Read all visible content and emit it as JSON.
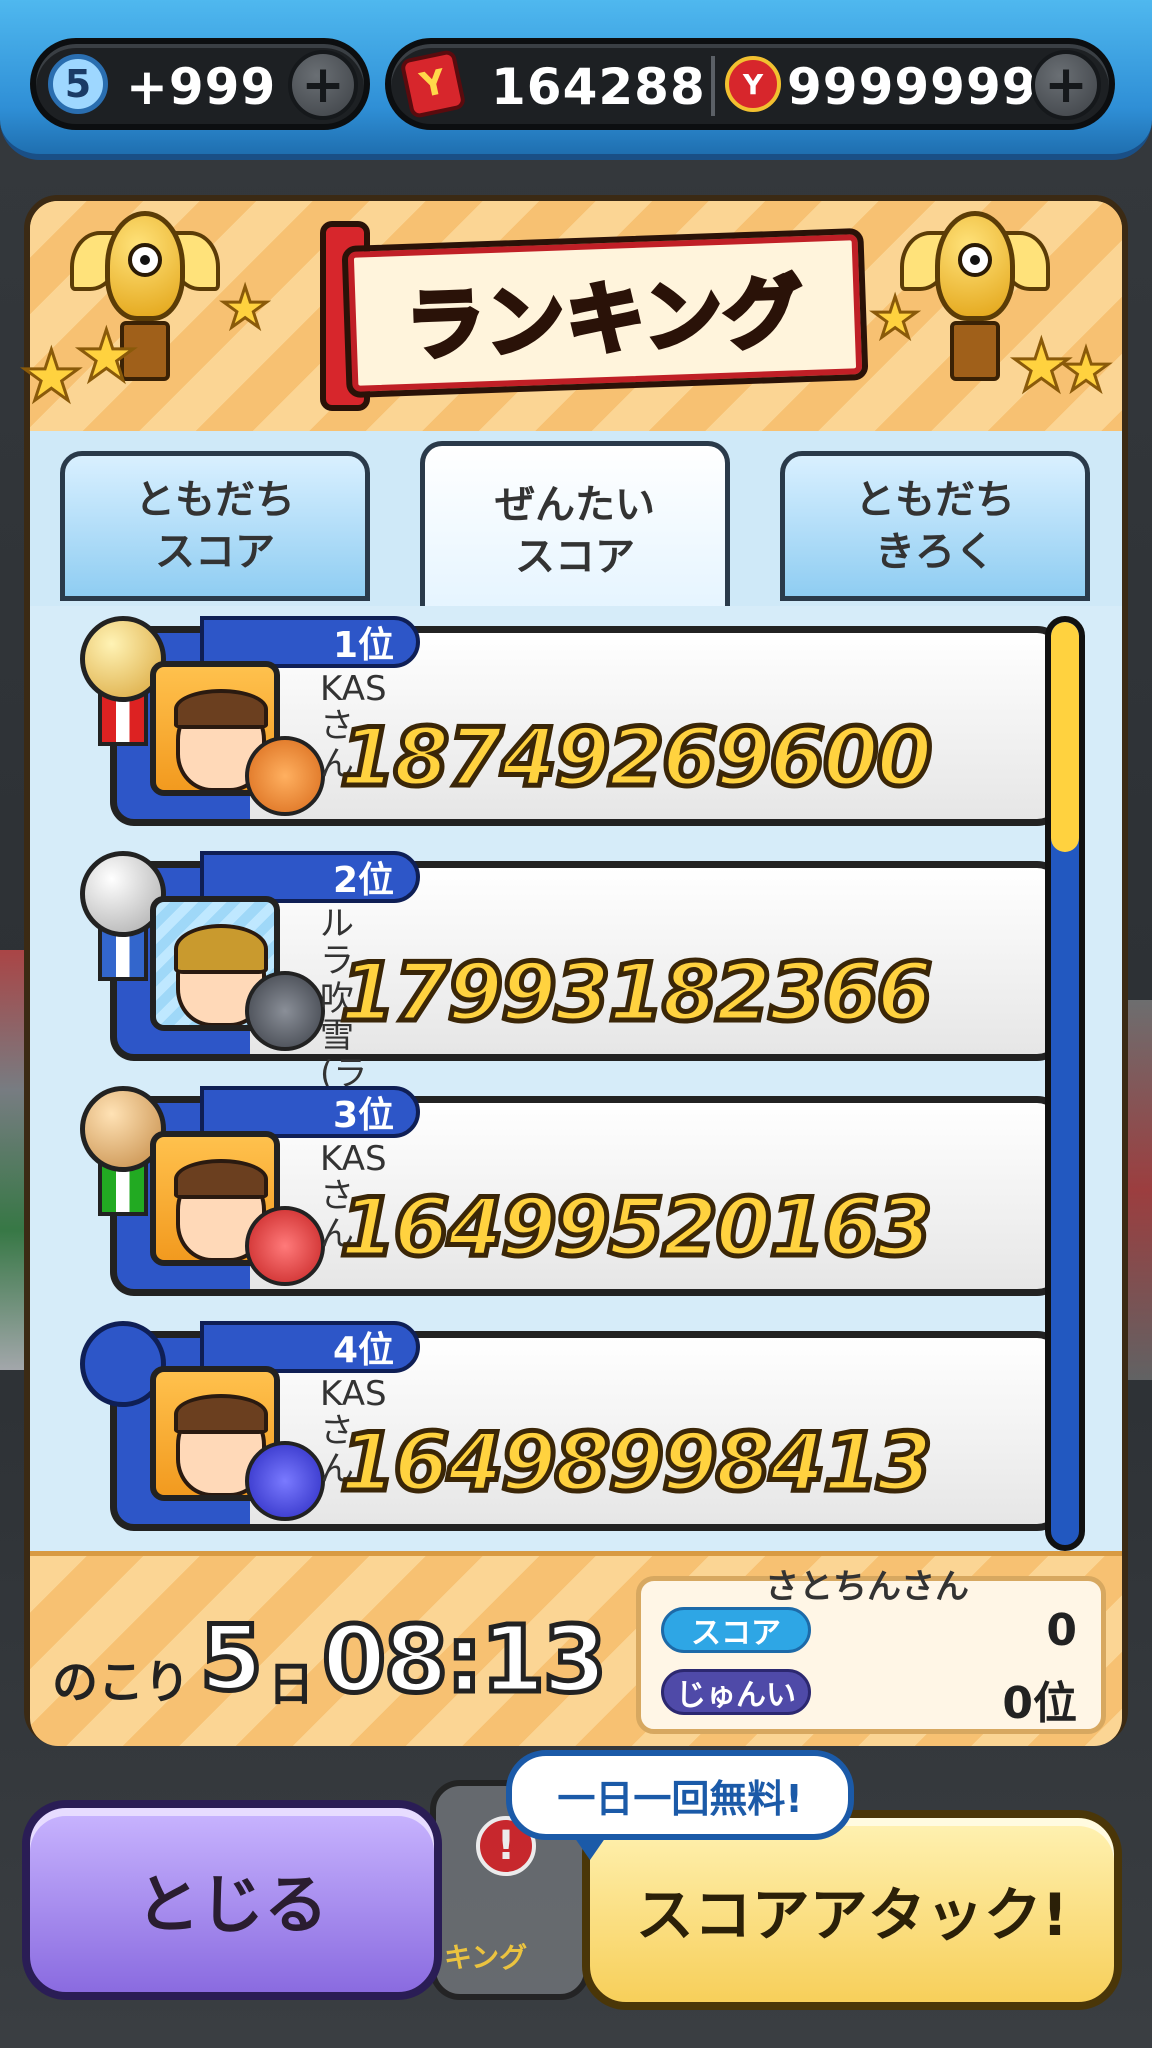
{
  "status_bar": {
    "spirit_level": "5",
    "spirit_count": "+999",
    "money": "164288",
    "coins": "9999999",
    "plus_label": "+"
  },
  "header": {
    "title": "ランキング"
  },
  "tabs": [
    {
      "line1": "ともだち",
      "line2": "スコア",
      "active": false
    },
    {
      "line1": "ぜんたい",
      "line2": "スコア",
      "active": true
    },
    {
      "line1": "ともだち",
      "line2": "きろく",
      "active": false
    }
  ],
  "ranking": [
    {
      "rank": "1位",
      "name": "KASさん",
      "score": "18749269600"
    },
    {
      "rank": "2位",
      "name": "ルラ吹雪(ライト)",
      "score": "17993182366"
    },
    {
      "rank": "3位",
      "name": "KASさん",
      "score": "16499520163"
    },
    {
      "rank": "4位",
      "name": "KASさん",
      "score": "16498998413"
    }
  ],
  "footer": {
    "remaining_label": "のこり",
    "days": "5",
    "days_unit": "日",
    "time": "08:13",
    "my_name": "さとちんさん",
    "score_tag": "スコア",
    "score_value": "0",
    "rank_tag": "じゅんい",
    "rank_value": "0位"
  },
  "buttons": {
    "close": "とじる",
    "attack": "スコアアタック!",
    "free_bubble": "一日一回無料!",
    "badge_label": "キング"
  },
  "colors": {
    "accent_blue": "#2d56c8",
    "gold": "#ffd23f",
    "panel_orange": "#f7c877"
  }
}
